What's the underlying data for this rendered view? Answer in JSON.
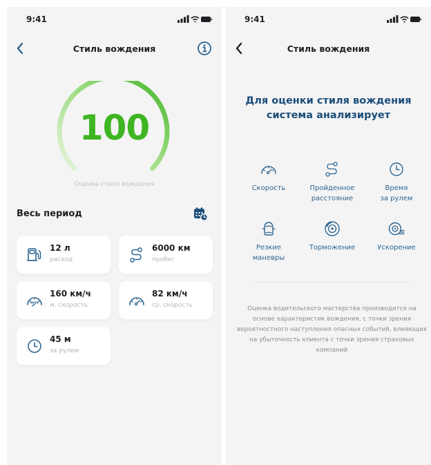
{
  "status_bar": {
    "time": "9:41"
  },
  "left": {
    "title": "Стиль вождения",
    "score": "100",
    "score_fraction": 1.0,
    "score_caption": "Оценка стиля вождения",
    "section_title": "Весь период",
    "cards": [
      {
        "icon": "fuel-pump-icon",
        "value": "12 л",
        "label": "расход"
      },
      {
        "icon": "route-icon",
        "value": "6000 км",
        "label": "пробег"
      },
      {
        "icon": "max-speedometer-icon",
        "value": "160 км/ч",
        "label": "м. скорость"
      },
      {
        "icon": "speedometer-icon",
        "value": "82 км/ч",
        "label": "ср. скорость"
      },
      {
        "icon": "clock-icon",
        "value": "45 м",
        "label": "за рулем"
      }
    ]
  },
  "right": {
    "title": "Стиль вождения",
    "heading": "Для оценки стиля вождения система анализирует",
    "factors": [
      {
        "icon": "speedometer-icon",
        "label": "Скорость"
      },
      {
        "icon": "route-icon",
        "label": "Пройденное\nрасстояние"
      },
      {
        "icon": "clock-icon",
        "label": "Время\nза рулем"
      },
      {
        "icon": "car-maneuver-icon",
        "label": "Резкие\nманевры"
      },
      {
        "icon": "brake-disc-icon",
        "label": "Торможение"
      },
      {
        "icon": "acceleration-icon",
        "label": "Ускорение"
      }
    ],
    "note": "Оценка водительского мастерства производится на основе характеристик вождения, с точки зрения вероятностного наступления опасных событий, влияющих на убыточность клиента с точки зрения страховых компаний"
  },
  "colors": {
    "accent_green": "#3fb523",
    "accent_blue": "#2c6590",
    "heading_blue": "#1c4e7a",
    "background": "#f4f4f5"
  }
}
